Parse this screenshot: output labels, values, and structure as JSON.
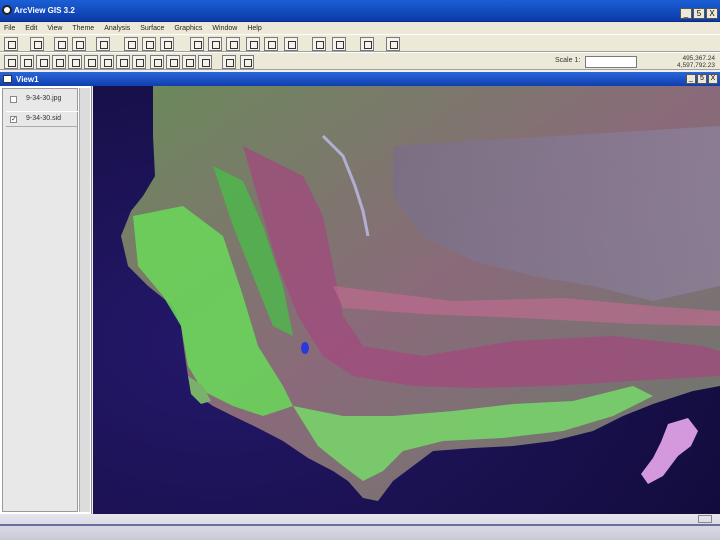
{
  "window": {
    "title": "ArcView GIS 3.2"
  },
  "menu": [
    "File",
    "Edit",
    "View",
    "Theme",
    "Analysis",
    "Surface",
    "Graphics",
    "Window",
    "Help"
  ],
  "toolbar": {
    "scale_label": "Scale 1:",
    "scale_value": "",
    "coord_x": "495,367.24",
    "coord_y": "4,597,792.23"
  },
  "view": {
    "title": "View1"
  },
  "layers": [
    {
      "name": "9-34-30.jpg",
      "checked": false
    },
    {
      "name": "9-34-30.sid",
      "checked": true
    }
  ],
  "window_buttons": {
    "minimize": "_",
    "restore": "5",
    "close": "X"
  },
  "colors": {
    "titlebar": "#0b3aa8",
    "ocean": "#17104a",
    "vegetation": "#6ad45a",
    "mountains": "#a24a7e"
  }
}
